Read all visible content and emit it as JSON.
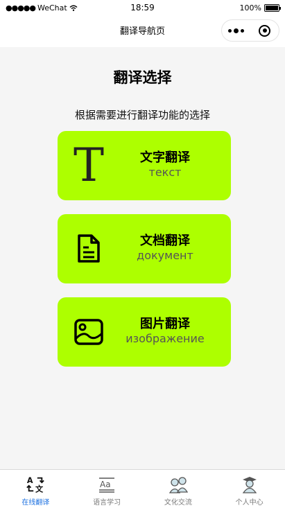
{
  "status_bar": {
    "carrier": "WeChat",
    "time": "18:59",
    "battery": "100%",
    "battery_level": 1.0
  },
  "nav": {
    "title": "翻译导航页"
  },
  "main": {
    "title": "翻译选择",
    "subtitle": "根据需要进行翻译功能的选择",
    "cards": [
      {
        "title": "文字翻译",
        "subtitle": "текст",
        "icon": "text-t-icon"
      },
      {
        "title": "文档翻译",
        "subtitle": "документ",
        "icon": "document-icon"
      },
      {
        "title": "图片翻译",
        "subtitle": "изображение",
        "icon": "image-icon"
      }
    ]
  },
  "tab_bar": {
    "items": [
      {
        "label": "在线翻译",
        "icon": "translate-icon",
        "active": true
      },
      {
        "label": "语言学习",
        "icon": "language-learning-icon",
        "active": false
      },
      {
        "label": "文化交流",
        "icon": "culture-exchange-icon",
        "active": false
      },
      {
        "label": "个人中心",
        "icon": "profile-icon",
        "active": false
      }
    ]
  },
  "colors": {
    "card": "#adff00",
    "active_tab": "#1a6fe0",
    "background": "#f5f5f5"
  }
}
